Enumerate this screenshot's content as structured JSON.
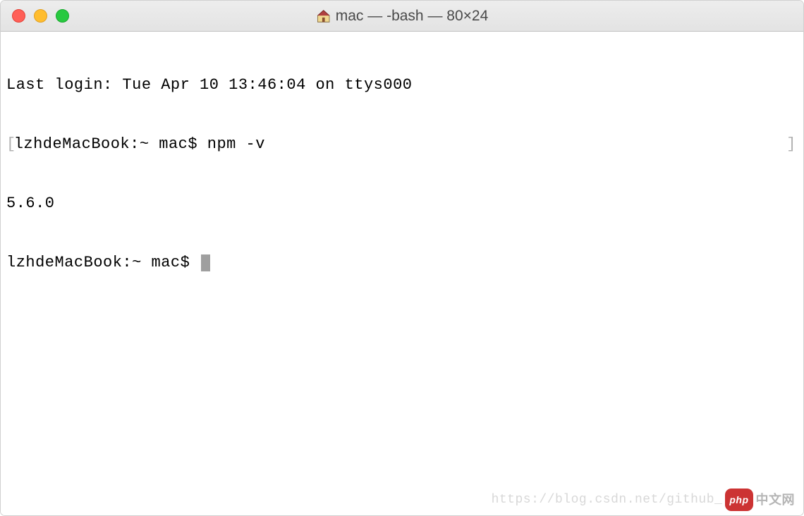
{
  "titlebar": {
    "title": "mac — -bash — 80×24"
  },
  "terminal": {
    "last_login": "Last login: Tue Apr 10 13:46:04 on ttys000",
    "prompt1": "lzhdeMacBook:~ mac$ ",
    "command1": "npm -v",
    "output1": "5.6.0",
    "prompt2": "lzhdeMacBook:~ mac$ "
  },
  "watermark": {
    "url": "https://blog.csdn.net/github_",
    "badge": "php",
    "cn": "中文网"
  }
}
